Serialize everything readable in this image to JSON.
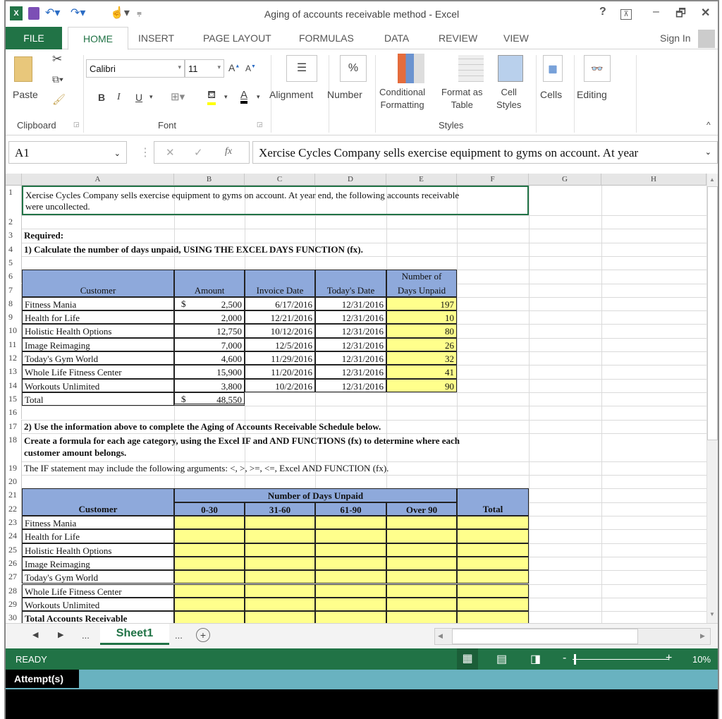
{
  "window": {
    "title": "Aging of accounts receivable method - Excel",
    "help": "?",
    "minimize": "–",
    "restore": "🗗",
    "close": "✕",
    "ribbon_display": "⊼"
  },
  "ribbon_tabs": [
    "FILE",
    "HOME",
    "INSERT",
    "PAGE LAYOUT",
    "FORMULAS",
    "DATA",
    "REVIEW",
    "VIEW"
  ],
  "active_tab": "HOME",
  "sign_in": "Sign In",
  "ribbon": {
    "paste": "Paste",
    "font_name": "Calibri",
    "font_size": "11",
    "bold": "B",
    "italic": "I",
    "underline": "U",
    "alignment": "Alignment",
    "number": "Number",
    "number_icon": "%",
    "conditional_formatting": [
      "Conditional",
      "Formatting"
    ],
    "format_as_table": [
      "Format as",
      "Table"
    ],
    "cell_styles": [
      "Cell",
      "Styles"
    ],
    "cells": "Cells",
    "editing": "Editing",
    "groups": {
      "clipboard": "Clipboard",
      "font": "Font",
      "styles": "Styles"
    }
  },
  "formula_bar": {
    "name_box": "A1",
    "fx": "fx",
    "content": "Xercise Cycles Company sells exercise equipment to gyms on account.  At year"
  },
  "columns": [
    "A",
    "B",
    "C",
    "D",
    "E",
    "F",
    "G",
    "H"
  ],
  "rows": [
    "1",
    "2",
    "3",
    "4",
    "5",
    "6",
    "7",
    "8",
    "9",
    "10",
    "11",
    "12",
    "13",
    "14",
    "15",
    "16",
    "17",
    "18",
    "19",
    "20",
    "21",
    "22",
    "23",
    "24",
    "25",
    "26",
    "27",
    "28",
    "29",
    "30"
  ],
  "sheet": {
    "intro_line1": "Xercise Cycles Company sells exercise equipment to gyms on account.  At year end, the following accounts receivable",
    "intro_line2": "were uncollected.",
    "required": "Required:",
    "task1": "1) Calculate the number of days unpaid, USING THE EXCEL DAYS FUNCTION (fx).",
    "days_table": {
      "headers": {
        "customer": "Customer",
        "amount": "Amount",
        "invoice_date": "Invoice Date",
        "todays_date": "Today's Date",
        "days_unpaid_1": "Number of",
        "days_unpaid_2": "Days Unpaid"
      },
      "currency": "$",
      "rows": [
        {
          "customer": "Fitness Mania",
          "amount": "2,500",
          "invoice_date": "6/17/2016",
          "todays_date": "12/31/2016",
          "days": "197"
        },
        {
          "customer": "Health for Life",
          "amount": "2,000",
          "invoice_date": "12/21/2016",
          "todays_date": "12/31/2016",
          "days": "10"
        },
        {
          "customer": "Holistic Health Options",
          "amount": "12,750",
          "invoice_date": "10/12/2016",
          "todays_date": "12/31/2016",
          "days": "80"
        },
        {
          "customer": "Image Reimaging",
          "amount": "7,000",
          "invoice_date": "12/5/2016",
          "todays_date": "12/31/2016",
          "days": "26"
        },
        {
          "customer": "Today's Gym World",
          "amount": "4,600",
          "invoice_date": "11/29/2016",
          "todays_date": "12/31/2016",
          "days": "32"
        },
        {
          "customer": "Whole Life Fitness Center",
          "amount": "15,900",
          "invoice_date": "11/20/2016",
          "todays_date": "12/31/2016",
          "days": "41"
        },
        {
          "customer": "Workouts Unlimited",
          "amount": "3,800",
          "invoice_date": "10/2/2016",
          "todays_date": "12/31/2016",
          "days": "90"
        }
      ],
      "total_label": "Total",
      "total_amount": "48,550"
    },
    "task2": "2) Use the information above to complete the Aging of Accounts Receivable Schedule below.",
    "task3_line1": "Create a formula for each age category, using the Excel IF and AND FUNCTIONS (fx) to determine where each",
    "task3_line2": "customer amount belongs.",
    "task4": "The IF statement may include the following arguments:  <, >, >=, <=, Excel AND FUNCTION (fx).",
    "aging_table": {
      "group_header": "Number of Days Unpaid",
      "customer_header": "Customer",
      "buckets": [
        "0-30",
        "31-60",
        "61-90",
        "Over 90"
      ],
      "total_header": "Total",
      "customers": [
        "Fitness Mania",
        "Health for Life",
        "Holistic Health Options",
        "Image Reimaging",
        "Today's Gym World",
        "Whole Life Fitness Center",
        "Workouts Unlimited"
      ],
      "total_label": "Total Accounts Receivable"
    }
  },
  "sheet_tabs": {
    "active": "Sheet1",
    "ellipsis": "...",
    "add": "+"
  },
  "status_bar": {
    "state": "READY",
    "zoom": "10%"
  },
  "attempts_label": "Attempt(s)",
  "colors": {
    "excel_green": "#217346",
    "header_blue": "#8EA9DB",
    "input_yellow": "#FFFF8C",
    "attempt_bar": "#69B2C0"
  }
}
